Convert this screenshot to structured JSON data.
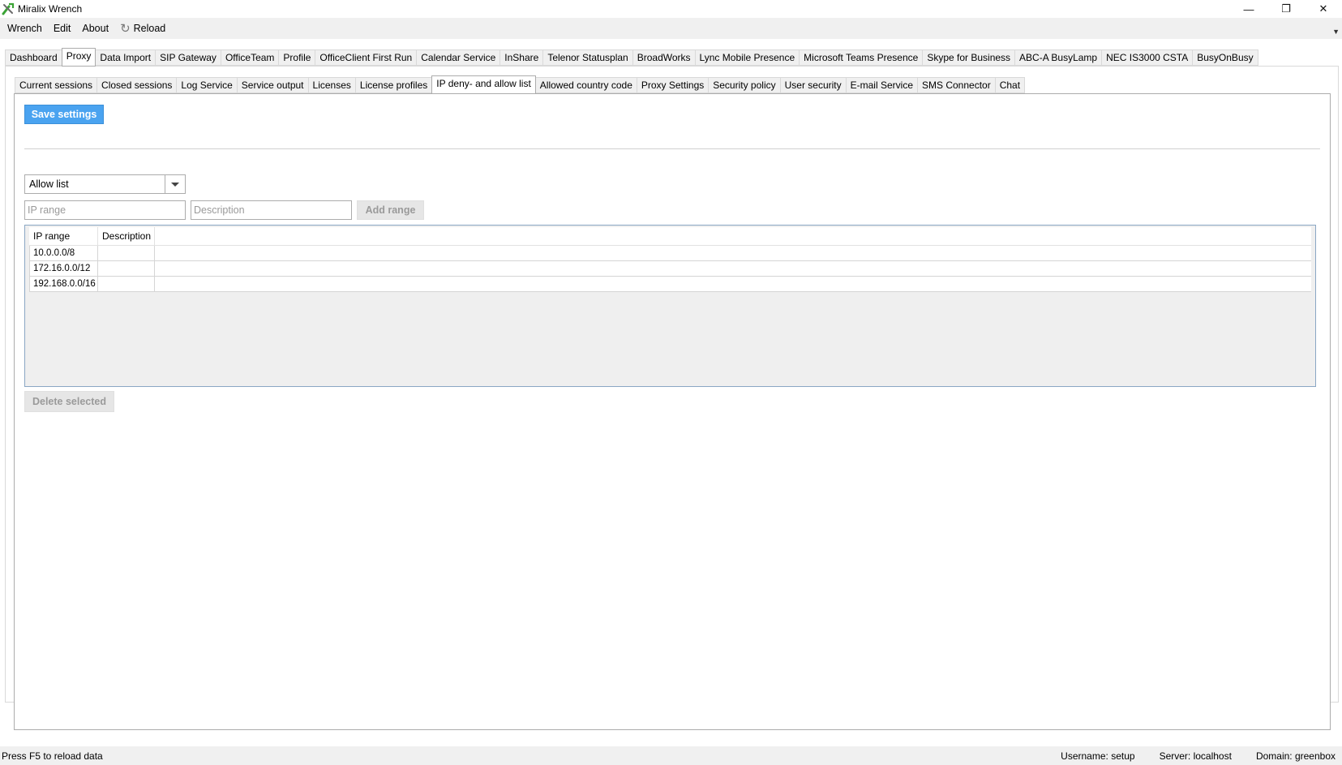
{
  "window": {
    "title": "Miralix Wrench",
    "minimize_glyph": "—",
    "restore_glyph": "❐",
    "close_glyph": "✕"
  },
  "menu": {
    "items": [
      "Wrench",
      "Edit",
      "About"
    ],
    "reload_label": "Reload"
  },
  "top_tabs": [
    "Dashboard",
    "Proxy",
    "Data Import",
    "SIP Gateway",
    "OfficeTeam",
    "Profile",
    "OfficeClient First Run",
    "Calendar Service",
    "InShare",
    "Telenor Statusplan",
    "BroadWorks",
    "Lync Mobile Presence",
    "Microsoft Teams Presence",
    "Skype for Business",
    "ABC-A BusyLamp",
    "NEC IS3000 CSTA",
    "BusyOnBusy"
  ],
  "top_tabs_active": "Proxy",
  "sub_tabs": [
    "Current sessions",
    "Closed sessions",
    "Log Service",
    "Service output",
    "Licenses",
    "License profiles",
    "IP deny- and allow list",
    "Allowed country code",
    "Proxy Settings",
    "Security policy",
    "User security",
    "E-mail Service",
    "SMS Connector",
    "Chat"
  ],
  "sub_tabs_active": "IP deny- and allow list",
  "content": {
    "save_label": "Save settings",
    "list_type_selected": "Allow list",
    "ip_range_placeholder": "IP range",
    "description_placeholder": "Description",
    "add_range_label": "Add range",
    "delete_selected_label": "Delete selected"
  },
  "grid": {
    "columns": [
      "IP range",
      "Description"
    ],
    "rows": [
      {
        "ip_range": "10.0.0.0/8",
        "description": ""
      },
      {
        "ip_range": "172.16.0.0/12",
        "description": ""
      },
      {
        "ip_range": "192.168.0.0/16",
        "description": ""
      }
    ]
  },
  "status": {
    "hint": "Press F5 to reload data",
    "username": "Username: setup",
    "server": "Server: localhost",
    "domain": "Domain: greenbox"
  },
  "colors": {
    "accent": "#4aa3f0",
    "grid_border": "#8aa7c4"
  }
}
